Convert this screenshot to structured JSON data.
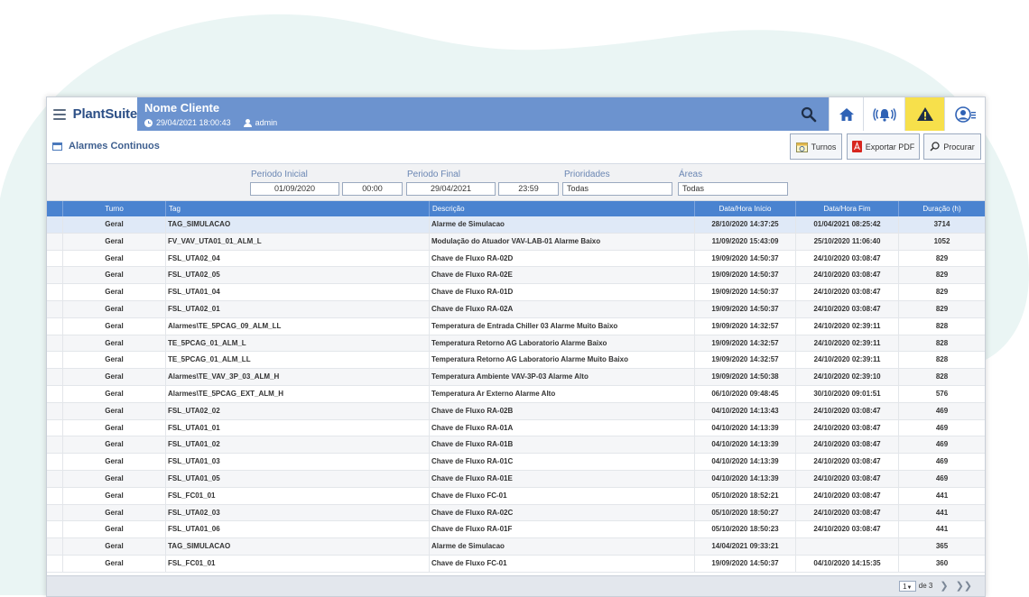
{
  "colors": {
    "header_bg": "#6c93cf",
    "table_header_bg": "#4a83d0",
    "warning_bg": "#f7e04b",
    "brand_text": "#2c4f86"
  },
  "header": {
    "brand": "PlantSuite",
    "client_name": "Nome Cliente",
    "datetime": "29/04/2021 18:00:43",
    "user": "admin",
    "icons": [
      "search-icon",
      "home-icon",
      "alarm-bell-icon",
      "warning-icon",
      "user-menu-icon"
    ]
  },
  "page": {
    "title": "Alarmes Continuos",
    "buttons": {
      "turnos": "Turnos",
      "export_pdf": "Exportar PDF",
      "procurar": "Procurar"
    }
  },
  "filters": {
    "periodo_inicial_label": "Periodo Inicial",
    "periodo_inicial_date": "01/09/2020",
    "periodo_inicial_time": "00:00",
    "periodo_final_label": "Periodo Final",
    "periodo_final_date": "29/04/2021",
    "periodo_final_time": "23:59",
    "prioridades_label": "Prioridades",
    "prioridades_value": "Todas",
    "areas_label": "Áreas",
    "areas_value": "Todas"
  },
  "table": {
    "columns": {
      "turno": "Turno",
      "tag": "Tag",
      "descricao": "Descrição",
      "inicio": "Data/Hora Início",
      "fim": "Data/Hora Fim",
      "duracao": "Duração (h)"
    },
    "rows": [
      {
        "turno": "Geral",
        "tag": "TAG_SIMULACAO",
        "descricao": "Alarme de Simulacao",
        "inicio": "28/10/2020 14:37:25",
        "fim": "01/04/2021 08:25:42",
        "duracao": "3714"
      },
      {
        "turno": "Geral",
        "tag": "FV_VAV_UTA01_01_ALM_L",
        "descricao": "Modulação do Atuador VAV-LAB-01 Alarme Baixo",
        "inicio": "11/09/2020 15:43:09",
        "fim": "25/10/2020 11:06:40",
        "duracao": "1052"
      },
      {
        "turno": "Geral",
        "tag": "FSL_UTA02_04",
        "descricao": "Chave de Fluxo RA-02D",
        "inicio": "19/09/2020 14:50:37",
        "fim": "24/10/2020 03:08:47",
        "duracao": "829"
      },
      {
        "turno": "Geral",
        "tag": "FSL_UTA02_05",
        "descricao": "Chave de Fluxo RA-02E",
        "inicio": "19/09/2020 14:50:37",
        "fim": "24/10/2020 03:08:47",
        "duracao": "829"
      },
      {
        "turno": "Geral",
        "tag": "FSL_UTA01_04",
        "descricao": "Chave de Fluxo RA-01D",
        "inicio": "19/09/2020 14:50:37",
        "fim": "24/10/2020 03:08:47",
        "duracao": "829"
      },
      {
        "turno": "Geral",
        "tag": "FSL_UTA02_01",
        "descricao": "Chave de Fluxo RA-02A",
        "inicio": "19/09/2020 14:50:37",
        "fim": "24/10/2020 03:08:47",
        "duracao": "829"
      },
      {
        "turno": "Geral",
        "tag": "Alarmes\\TE_5PCAG_09_ALM_LL",
        "descricao": "Temperatura de Entrada Chiller 03 Alarme Muito Baixo",
        "inicio": "19/09/2020 14:32:57",
        "fim": "24/10/2020 02:39:11",
        "duracao": "828"
      },
      {
        "turno": "Geral",
        "tag": "TE_5PCAG_01_ALM_L",
        "descricao": "Temperatura Retorno AG Laboratorio Alarme Baixo",
        "inicio": "19/09/2020 14:32:57",
        "fim": "24/10/2020 02:39:11",
        "duracao": "828"
      },
      {
        "turno": "Geral",
        "tag": "TE_5PCAG_01_ALM_LL",
        "descricao": "Temperatura Retorno AG Laboratorio Alarme Muito Baixo",
        "inicio": "19/09/2020 14:32:57",
        "fim": "24/10/2020 02:39:11",
        "duracao": "828"
      },
      {
        "turno": "Geral",
        "tag": "Alarmes\\TE_VAV_3P_03_ALM_H",
        "descricao": "Temperatura Ambiente VAV-3P-03 Alarme Alto",
        "inicio": "19/09/2020 14:50:38",
        "fim": "24/10/2020 02:39:10",
        "duracao": "828"
      },
      {
        "turno": "Geral",
        "tag": "Alarmes\\TE_5PCAG_EXT_ALM_H",
        "descricao": "Temperatura Ar Externo Alarme Alto",
        "inicio": "06/10/2020 09:48:45",
        "fim": "30/10/2020 09:01:51",
        "duracao": "576"
      },
      {
        "turno": "Geral",
        "tag": "FSL_UTA02_02",
        "descricao": "Chave de Fluxo RA-02B",
        "inicio": "04/10/2020 14:13:43",
        "fim": "24/10/2020 03:08:47",
        "duracao": "469"
      },
      {
        "turno": "Geral",
        "tag": "FSL_UTA01_01",
        "descricao": "Chave de Fluxo RA-01A",
        "inicio": "04/10/2020 14:13:39",
        "fim": "24/10/2020 03:08:47",
        "duracao": "469"
      },
      {
        "turno": "Geral",
        "tag": "FSL_UTA01_02",
        "descricao": "Chave de Fluxo RA-01B",
        "inicio": "04/10/2020 14:13:39",
        "fim": "24/10/2020 03:08:47",
        "duracao": "469"
      },
      {
        "turno": "Geral",
        "tag": "FSL_UTA01_03",
        "descricao": "Chave de Fluxo RA-01C",
        "inicio": "04/10/2020 14:13:39",
        "fim": "24/10/2020 03:08:47",
        "duracao": "469"
      },
      {
        "turno": "Geral",
        "tag": "FSL_UTA01_05",
        "descricao": "Chave de Fluxo RA-01E",
        "inicio": "04/10/2020 14:13:39",
        "fim": "24/10/2020 03:08:47",
        "duracao": "469"
      },
      {
        "turno": "Geral",
        "tag": "FSL_FC01_01",
        "descricao": "Chave de Fluxo FC-01",
        "inicio": "05/10/2020 18:52:21",
        "fim": "24/10/2020 03:08:47",
        "duracao": "441"
      },
      {
        "turno": "Geral",
        "tag": "FSL_UTA02_03",
        "descricao": "Chave de Fluxo RA-02C",
        "inicio": "05/10/2020 18:50:27",
        "fim": "24/10/2020 03:08:47",
        "duracao": "441"
      },
      {
        "turno": "Geral",
        "tag": "FSL_UTA01_06",
        "descricao": "Chave de Fluxo RA-01F",
        "inicio": "05/10/2020 18:50:23",
        "fim": "24/10/2020 03:08:47",
        "duracao": "441"
      },
      {
        "turno": "Geral",
        "tag": "TAG_SIMULACAO",
        "descricao": "Alarme de Simulacao",
        "inicio": "14/04/2021 09:33:21",
        "fim": "",
        "duracao": "365"
      },
      {
        "turno": "Geral",
        "tag": "FSL_FC01_01",
        "descricao": "Chave de Fluxo FC-01",
        "inicio": "19/09/2020 14:50:37",
        "fim": "04/10/2020 14:15:35",
        "duracao": "360"
      }
    ]
  },
  "pagination": {
    "current_page": "1",
    "of_pages": "de 3"
  }
}
